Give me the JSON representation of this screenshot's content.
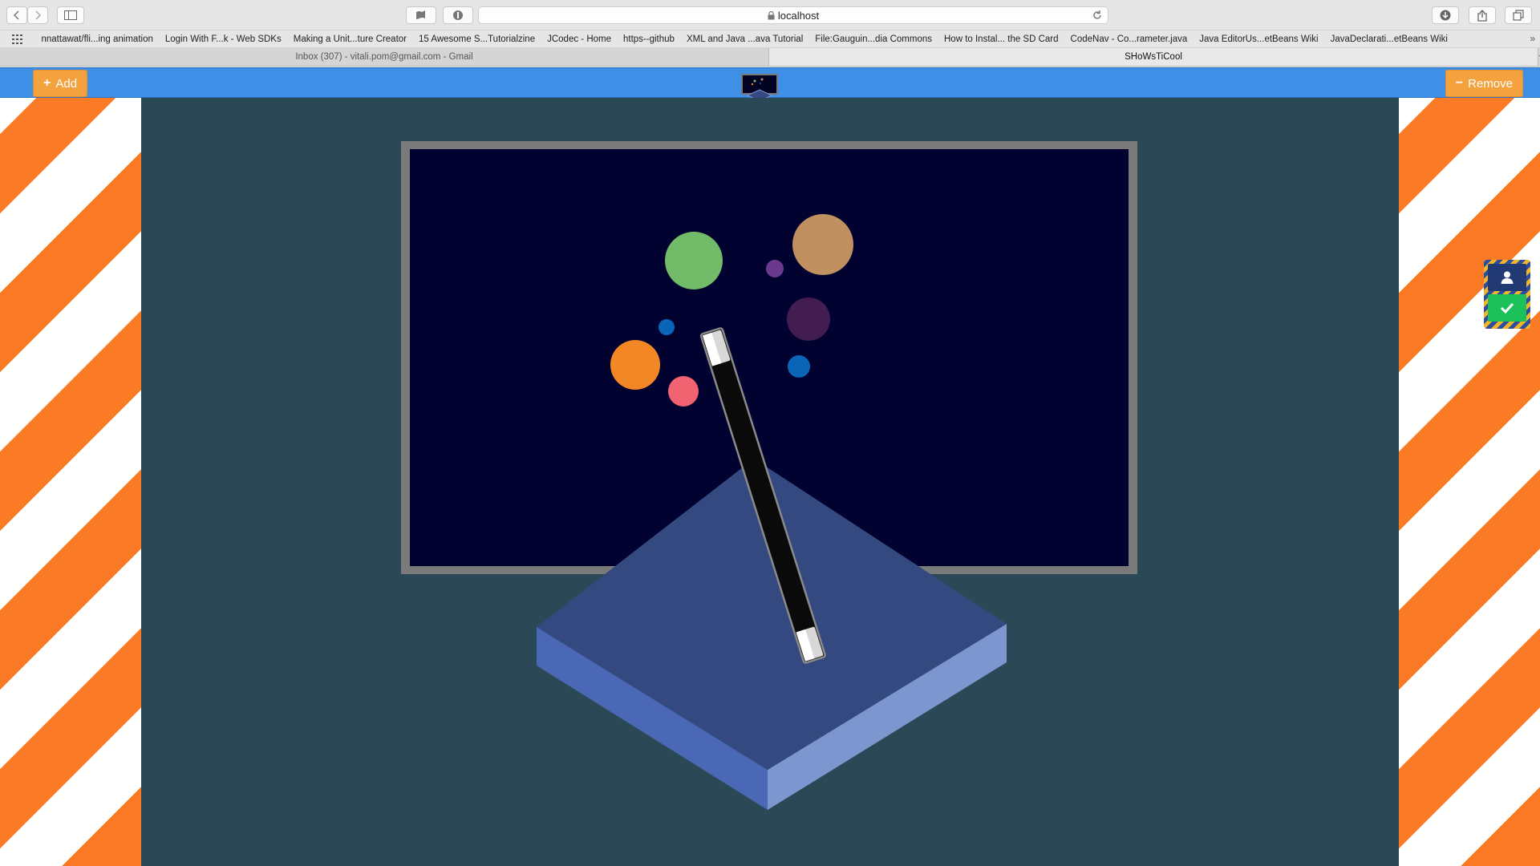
{
  "browser": {
    "url": "localhost",
    "bookmarks": [
      "nnattawat/fli...ing animation",
      "Login With F...k - Web SDKs",
      "Making a Unit...ture Creator",
      "15 Awesome S...Tutorialzine",
      "JCodec - Home",
      "https--github",
      "XML and Java ...ava Tutorial",
      "File:Gauguin...dia Commons",
      "How to Instal... the SD Card",
      "CodeNav - Co...rameter.java",
      "Java EditorUs...etBeans Wiki",
      "JavaDeclarati...etBeans Wiki"
    ],
    "tabs": [
      {
        "title": "Inbox (307) - vitali.pom@gmail.com - Gmail",
        "active": false
      },
      {
        "title": "SHoWsTiCool",
        "active": true
      }
    ]
  },
  "app": {
    "add_label": "Add",
    "remove_label": "Remove",
    "side_panel": [
      "user-icon",
      "check-icon"
    ]
  },
  "colors": {
    "header": "#3f8fe6",
    "button": "#f3a23d",
    "stage_bg": "#2b4857",
    "screen_bg": "#020230",
    "stripe_orange": "#fb7a26",
    "platform_top": "#34497f",
    "platform_left": "#4a68b6",
    "platform_right": "#7c96d0",
    "check_green": "#1cc15a"
  },
  "scene": {
    "bubbles": [
      {
        "color": "#72bb68"
      },
      {
        "color": "#c09061"
      },
      {
        "color": "#6b3a8f"
      },
      {
        "color": "#0b65b6"
      },
      {
        "color": "#431d52"
      },
      {
        "color": "#f38625"
      },
      {
        "color": "#f16371"
      },
      {
        "color": "#0b65b6"
      }
    ]
  }
}
